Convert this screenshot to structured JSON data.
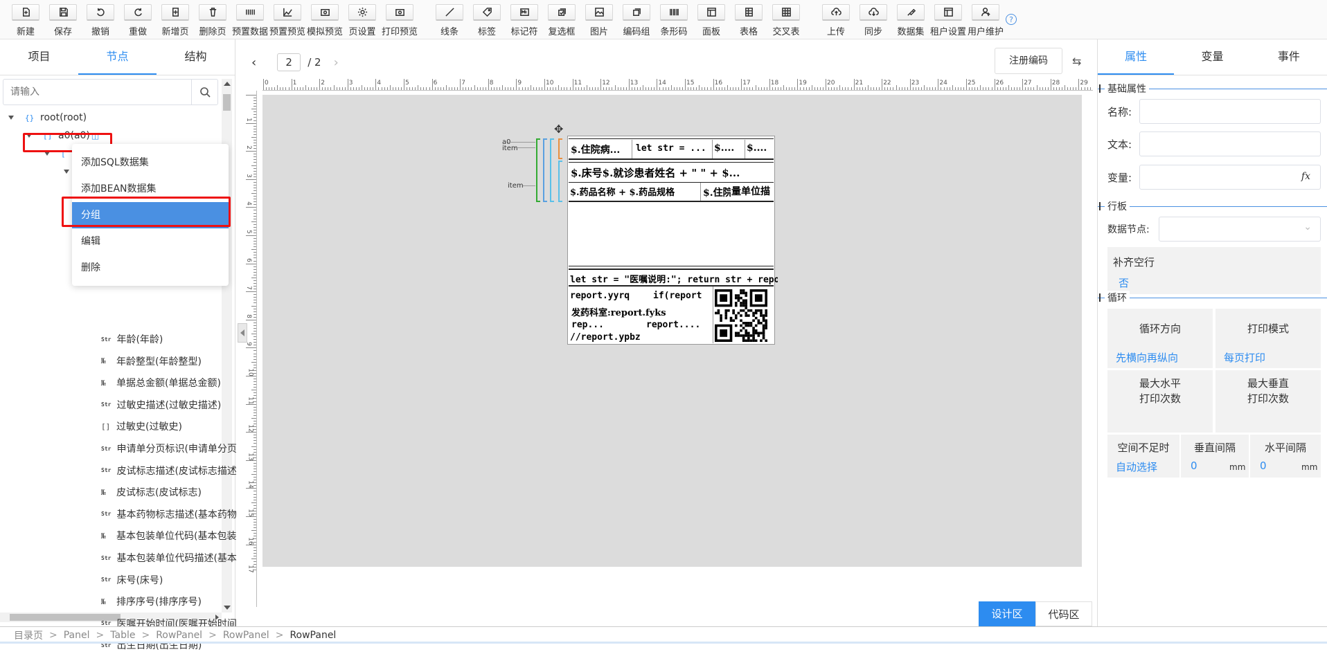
{
  "toolbar": {
    "items": [
      {
        "label": "新建",
        "icon": "new-file-icon"
      },
      {
        "label": "保存",
        "icon": "save-icon"
      },
      {
        "label": "撤销",
        "icon": "undo-icon"
      },
      {
        "label": "重做",
        "icon": "redo-icon"
      },
      {
        "label": "新增页",
        "icon": "add-page-icon"
      },
      {
        "label": "删除页",
        "icon": "delete-page-icon"
      },
      {
        "label": "预置数据",
        "icon": "preset-data-icon"
      },
      {
        "label": "预置预览",
        "icon": "preset-preview-icon"
      },
      {
        "label": "模拟预览",
        "icon": "simulate-preview-icon"
      },
      {
        "label": "页设置",
        "icon": "page-settings-icon"
      },
      {
        "label": "打印预览",
        "icon": "print-preview-icon"
      },
      {
        "label": "线条",
        "icon": "line-icon"
      },
      {
        "label": "标签",
        "icon": "label-tag-icon"
      },
      {
        "label": "标记符",
        "icon": "marker-icon"
      },
      {
        "label": "复选框",
        "icon": "checkbox-icon"
      },
      {
        "label": "图片",
        "icon": "image-icon"
      },
      {
        "label": "编码组",
        "icon": "code-group-icon"
      },
      {
        "label": "条形码",
        "icon": "barcode-icon"
      },
      {
        "label": "面板",
        "icon": "panel-icon"
      },
      {
        "label": "表格",
        "icon": "table-icon"
      },
      {
        "label": "交叉表",
        "icon": "crosstab-icon"
      },
      {
        "label": "上传",
        "icon": "upload-icon"
      },
      {
        "label": "同步",
        "icon": "sync-icon"
      },
      {
        "label": "数据集",
        "icon": "dataset-icon"
      },
      {
        "label": "租户设置",
        "icon": "tenant-settings-icon"
      },
      {
        "label": "用户维护",
        "icon": "user-maintenance-icon"
      }
    ]
  },
  "left": {
    "tabs": [
      "项目",
      "节点",
      "结构"
    ],
    "search_placeholder": "请输入",
    "tree": {
      "root": "root(root)",
      "a0": "a0(a0)",
      "items": [
        {
          "icon": "Str",
          "label": "年龄(年龄)"
        },
        {
          "icon": "№",
          "label": "年龄整型(年龄整型)"
        },
        {
          "icon": "№",
          "label": "单据总金额(单据总金额)"
        },
        {
          "icon": "Str",
          "label": "过敏史描述(过敏史描述)"
        },
        {
          "icon": "[]",
          "label": "过敏史(过敏史)"
        },
        {
          "icon": "Str",
          "label": "申请单分页标识(申请单分页标识)"
        },
        {
          "icon": "Str",
          "label": "皮试标志描述(皮试标志描述)"
        },
        {
          "icon": "№",
          "label": "皮试标志(皮试标志)"
        },
        {
          "icon": "Str",
          "label": "基本药物标志描述(基本药物标志描述)"
        },
        {
          "icon": "№",
          "label": "基本包装单位代码(基本包装单位代码)"
        },
        {
          "icon": "Str",
          "label": "基本包装单位代码描述(基本包装单位代码描述)"
        },
        {
          "icon": "Str",
          "label": "床号(床号)"
        },
        {
          "icon": "№",
          "label": "排序序号(排序序号)"
        },
        {
          "icon": "Str",
          "label": "医嘱开始时间(医嘱开始时间)"
        },
        {
          "icon": "Str",
          "label": "出生日期(出生日期)"
        }
      ]
    },
    "context_menu": [
      "添加SQL数据集",
      "添加BEAN数据集",
      "分组",
      "编辑",
      "删除"
    ]
  },
  "center": {
    "page_current": "2",
    "page_total": "/ 2",
    "register_button": "注册编码",
    "design_tab": "设计区",
    "code_tab": "代码区",
    "band_labels": [
      "a0",
      "item",
      "item"
    ],
    "report_cells": {
      "r1c1": "$.住院病...",
      "r1c2": "let str = ...",
      "r1c3": "$....",
      "r1c4": "$....",
      "r2": "$.床号$.就诊患者姓名 + \" \" + $...",
      "r3c1": "$.药品名称 + $.药品规格",
      "r3c2": "$.住院",
      "r3c3": "量单位描",
      "r4": "let str = \"医嘱说明:\"; return str + report.yzsm;;",
      "r5c1": "report.yyrq",
      "r5c2": "if(report",
      "r6": "发药科室:report.fyks",
      "r7c1": "rep...",
      "r7c2": "report....",
      "r8": "//report.ypbz"
    }
  },
  "right": {
    "tabs": [
      "属性",
      "变量",
      "事件"
    ],
    "basic_section": "基础属性",
    "name_label": "名称:",
    "text_label": "文本:",
    "var_label": "变量:",
    "fx": "fx",
    "rowband_section": "行板",
    "data_node_label": "数据节点:",
    "fill_empty_label": "补齐空行",
    "fill_empty_value": "否",
    "loop_section": "循环",
    "loop_direction_label": "循环方向",
    "loop_direction_value": "先横向再纵向",
    "print_mode_label": "打印模式",
    "print_mode_value": "每页打印",
    "max_h_label_1": "最大水平",
    "max_h_label_2": "打印次数",
    "max_v_label_1": "最大垂直",
    "max_v_label_2": "打印次数",
    "space_label": "空间不足时",
    "space_value": "自动选择",
    "vgap_label": "垂直间隔",
    "vgap_value": "0",
    "hgap_label": "水平间隔",
    "hgap_value": "0",
    "unit": "mm"
  },
  "breadcrumb": [
    "目录页",
    "Panel",
    "Table",
    "RowPanel",
    "RowPanel",
    "RowPanel"
  ],
  "colors": {
    "accent": "#2d8cf0",
    "highlight": "#4a90e2",
    "alert": "#e11111"
  }
}
